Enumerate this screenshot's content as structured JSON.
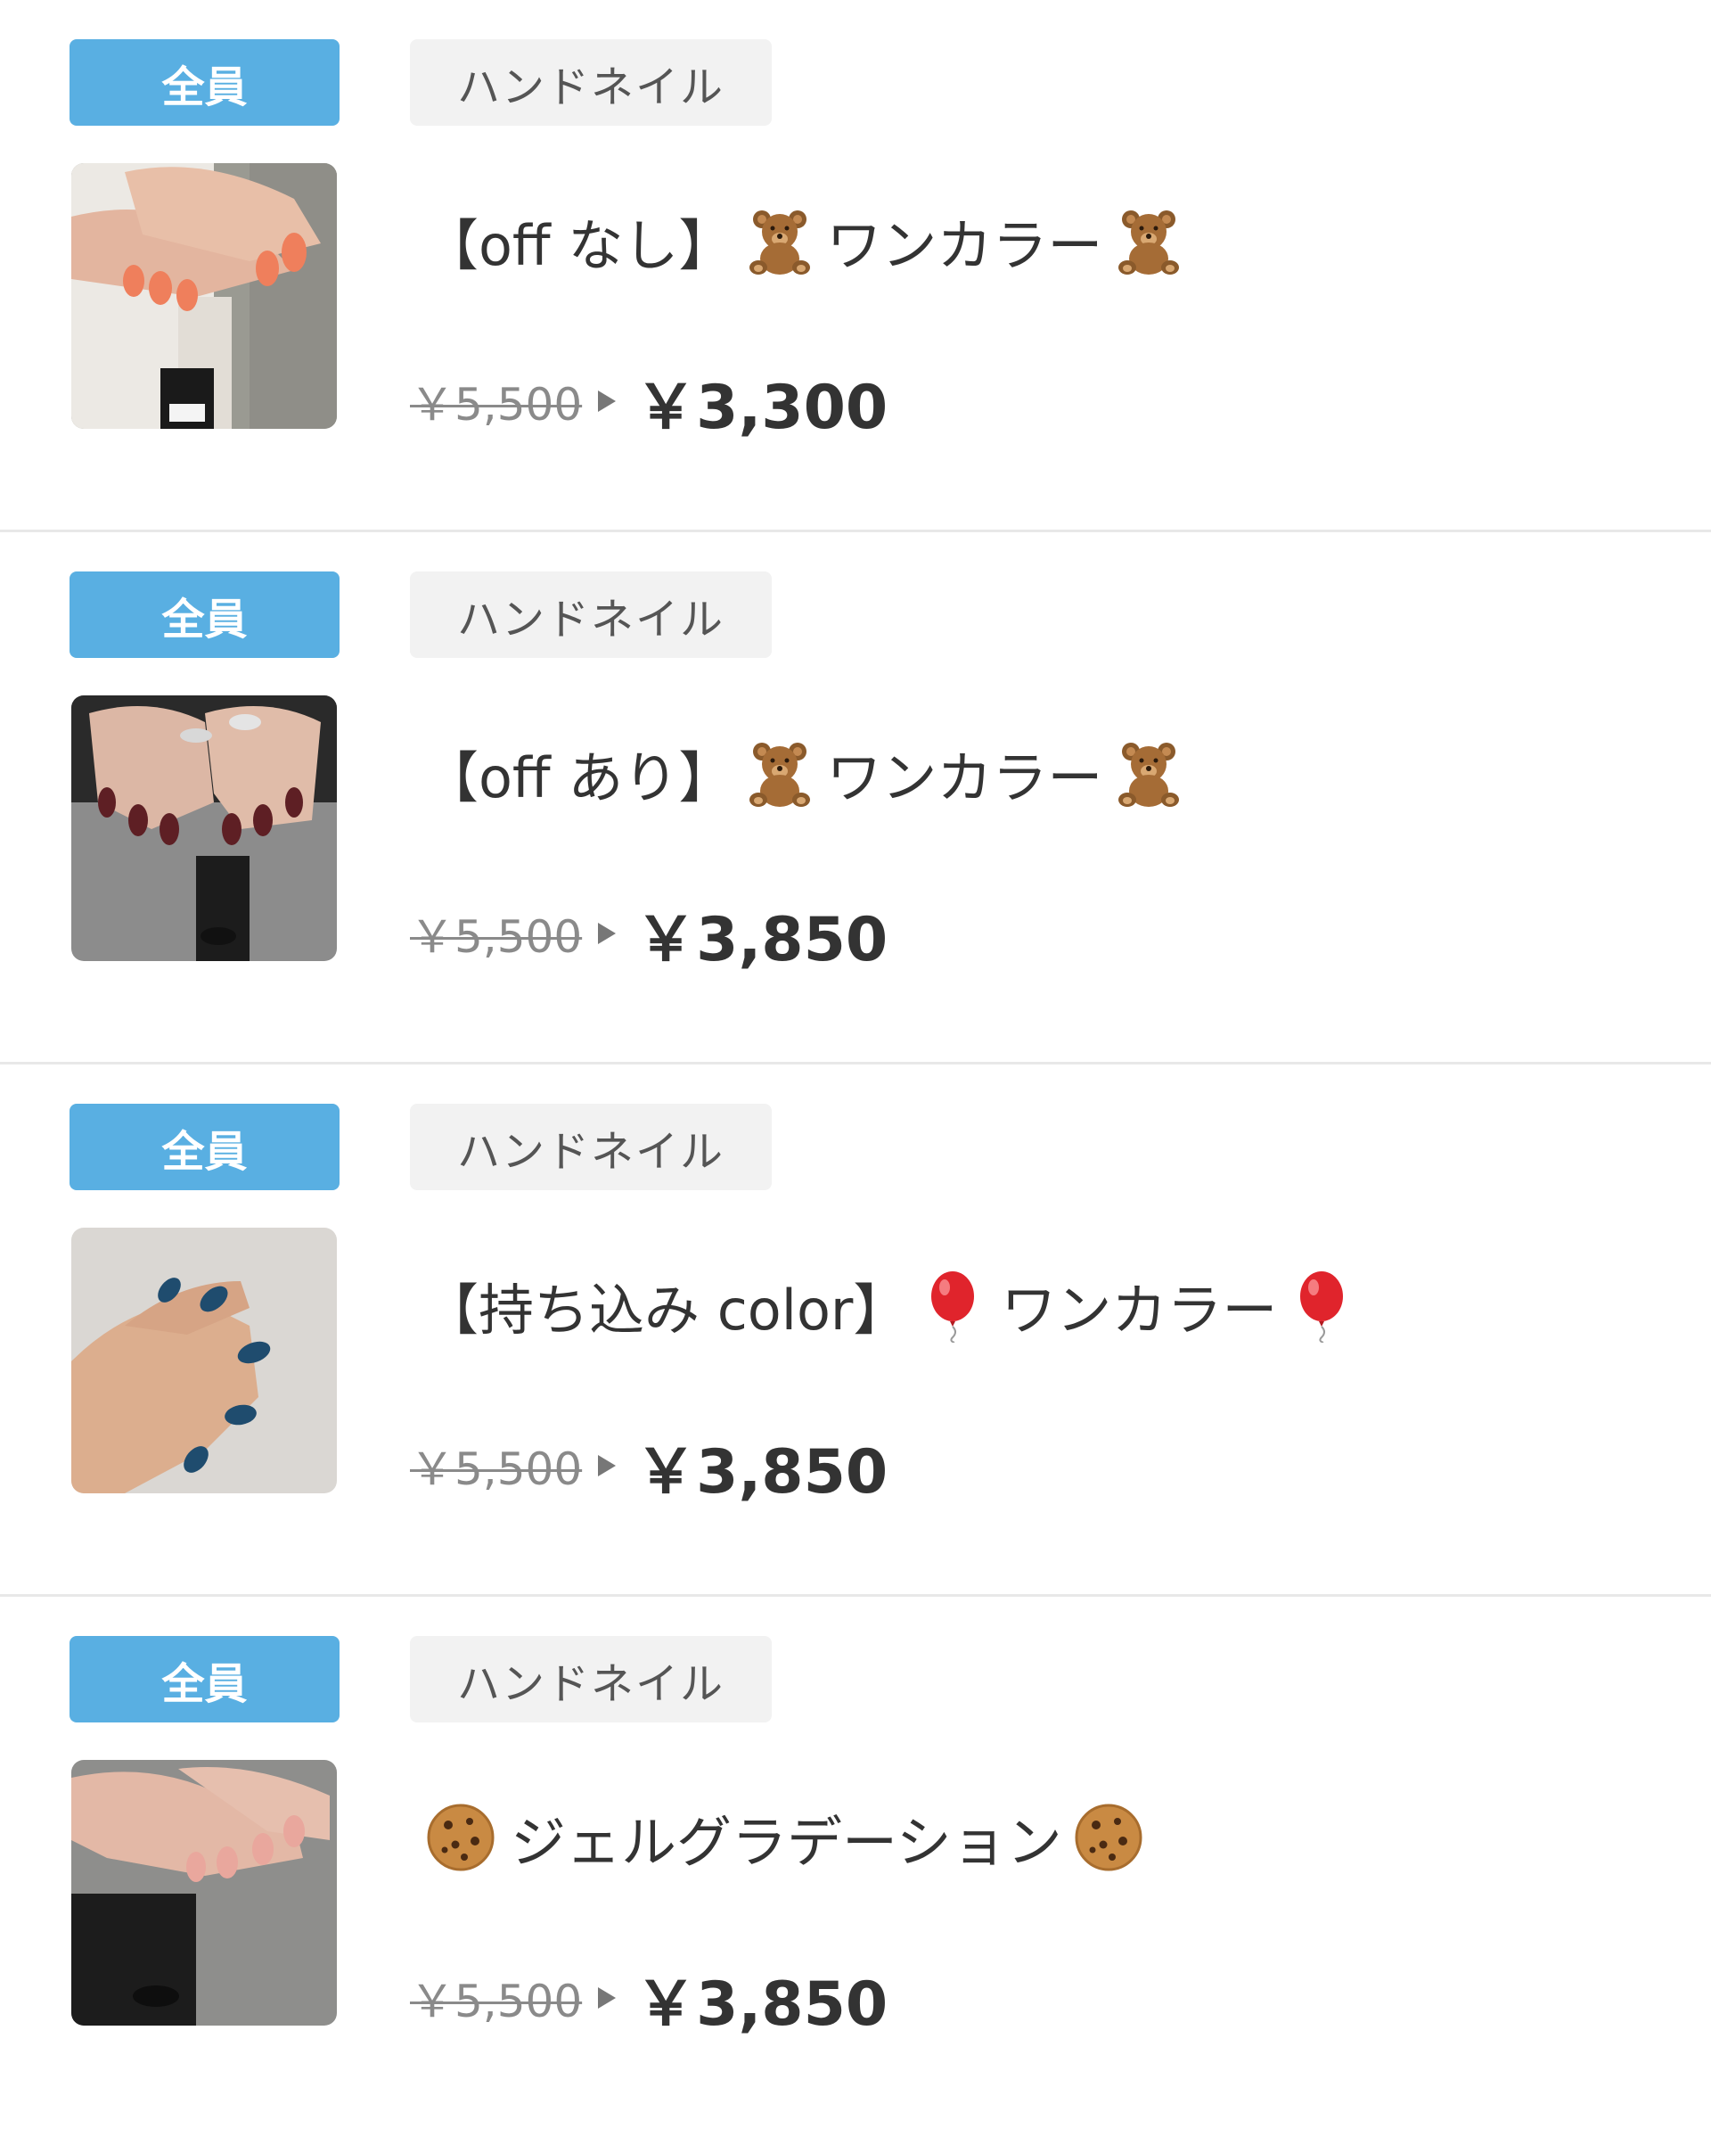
{
  "items": [
    {
      "badge": "全員",
      "category": "ハンドネイル",
      "title_prefix": "【off なし】",
      "title_main": "ワンカラー",
      "emoji_icon": "teddy-bear-icon",
      "thumbnail": "coral-nails-photo",
      "price_old": "￥5,500",
      "price_new": "￥3,300"
    },
    {
      "badge": "全員",
      "category": "ハンドネイル",
      "title_prefix": "【off あり】",
      "title_main": "ワンカラー",
      "emoji_icon": "teddy-bear-icon",
      "thumbnail": "burgundy-nails-photo",
      "price_old": "￥5,500",
      "price_new": "￥3,850"
    },
    {
      "badge": "全員",
      "category": "ハンドネイル",
      "title_prefix": "【持ち込み color】",
      "title_main": "ワンカラー",
      "emoji_icon": "red-balloon-icon",
      "thumbnail": "navy-nails-photo",
      "price_old": "￥5,500",
      "price_new": "￥3,850"
    },
    {
      "badge": "全員",
      "category": "ハンドネイル",
      "title_prefix": "",
      "title_main": "ジェルグラデーション",
      "emoji_icon": "cookie-icon",
      "thumbnail": "nude-nails-photo",
      "price_old": "￥5,500",
      "price_new": "￥3,850"
    }
  ],
  "colors": {
    "badge_all_bg": "#59afe2",
    "badge_category_bg": "#f2f2f2",
    "divider": "#e8e8e8"
  }
}
